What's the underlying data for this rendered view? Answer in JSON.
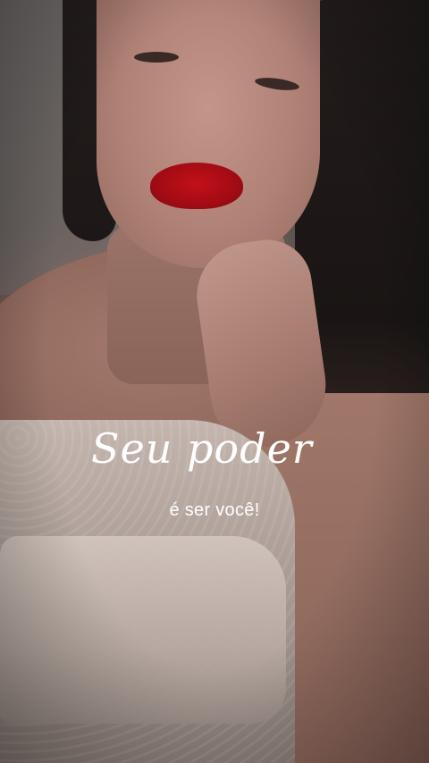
{
  "story": {
    "headline": "Seu poder",
    "caption": "é ser você!"
  }
}
